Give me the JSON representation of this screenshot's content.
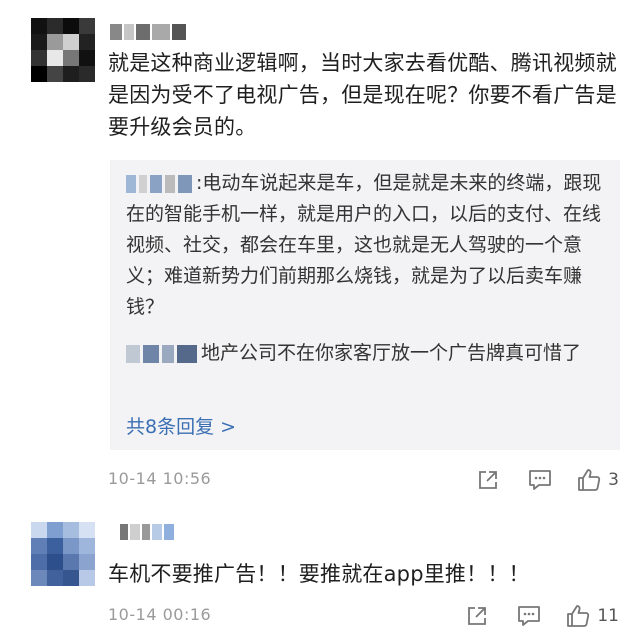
{
  "comments": [
    {
      "text": "就是这种商业逻辑啊，当时大家去看优酷、腾讯视频就是因为受不了电视广告，但是现在呢？你要不看广告是要升级会员的。",
      "replies": [
        {
          "separator": ":",
          "text": "电动车说起来是车，但是就是未来的终端，跟现在的智能手机一样，就是用户的入口，以后的支付、在线视频、社交，都会在车里，这也就是无人驾驶的一个意义；难道新势力们前期那么烧钱，就是为了以后卖车赚钱？"
        },
        {
          "separator": "",
          "text": "地产公司不在你家客厅放一个广告牌真可惜了"
        }
      ],
      "more_replies": "共8条回复 >",
      "time": "10-14 10:56",
      "like_count": "3"
    },
    {
      "text": "车机不要推广告！！要推就在app里推！！！",
      "time": "10-14 00:16",
      "like_count": "11"
    }
  ],
  "icons": [
    "share-icon",
    "comment-icon",
    "like-icon"
  ],
  "colors": {
    "link": "#3a6fb4",
    "meta": "#9a9a9a",
    "reply_bg": "#f3f3f5"
  }
}
